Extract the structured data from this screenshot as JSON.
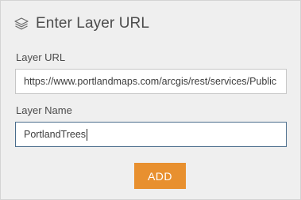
{
  "header": {
    "icon": "layers-icon",
    "title": "Enter Layer URL"
  },
  "form": {
    "layer_url_label": "Layer URL",
    "layer_url_value": "https://www.portlandmaps.com/arcgis/rest/services/Public",
    "layer_name_label": "Layer Name",
    "layer_name_value": "PortlandTrees"
  },
  "actions": {
    "add_label": "ADD"
  },
  "colors": {
    "accent": "#e8902f",
    "panel_bg": "#efefef",
    "focus_border": "#4a6d8c"
  }
}
